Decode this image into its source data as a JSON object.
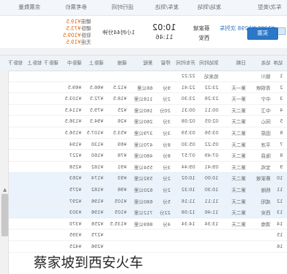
{
  "header": {
    "col_type": "车次/类型",
    "col_station": "发站/到站",
    "col_time": "发车/到达",
    "col_duration": "运行时间",
    "col_price": "参考票价",
    "col_ticket": "余票数量"
  },
  "train": {
    "number": "K1295/K1298 次列车",
    "type": "快速",
    "from": "蔡家坡",
    "to": "西安",
    "dep": "10:02",
    "arr": "11:46",
    "duration": "1小时44分钟",
    "prices": [
      {
        "label": "硬座",
        "value": "¥19.5"
      },
      {
        "label": "硬卧",
        "value": "¥73.5"
      },
      {
        "label": "软卧",
        "value": "¥109.5"
      },
      {
        "label": "无座",
        "value": "¥19.5"
      }
    ],
    "buy_label": "买票"
  },
  "table": {
    "columns": [
      "站序",
      "站名",
      "日期",
      "到站时间",
      "开车时间",
      "停留",
      "里程",
      "硬座",
      "硬卧上",
      "硬卧中",
      "硬卧下",
      "软卧上",
      "软卧下"
    ],
    "rows": [
      {
        "seq": "1",
        "station": "银川",
        "day": "",
        "arr": "始发站",
        "dep": "22:22",
        "stop": "",
        "km": "",
        "yz": "",
        "ys": "",
        "yzh": "",
        "yx": "",
        "rs": "",
        "rx": ""
      },
      {
        "seq": "2",
        "station": "青铜峡",
        "day": "第一天",
        "arr": "23:22",
        "dep": "22:41",
        "stop": "9分",
        "km": "66公里",
        "yz": "¥12.5",
        "ys": "¥66.5",
        "yzh": "¥69.5",
        "yx": "",
        "rs": "",
        "rx": ""
      },
      {
        "seq": "3",
        "station": "中宁",
        "day": "第一天",
        "arr": "23:28",
        "dep": "23:30",
        "stop": "2分",
        "km": "118公里",
        "yz": "¥18.5",
        "ys": "¥72.5",
        "yzh": "¥103.5",
        "yx": "",
        "rs": "",
        "rx": ""
      },
      {
        "seq": "4",
        "station": "中卫",
        "day": "第二天",
        "arr": "00:11",
        "dep": "00:31",
        "stop": "20分",
        "km": "160公里",
        "yz": "¥25",
        "ys": "¥79.5",
        "yzh": "¥114.5",
        "yx": "",
        "rs": "",
        "rx": ""
      },
      {
        "seq": "5",
        "station": "同心",
        "day": "第二天",
        "arr": "02:05",
        "dep": "02:08",
        "stop": "3分",
        "km": "260公里",
        "yz": "¥26",
        "ys": "¥94.5",
        "yzh": "¥136.5",
        "yx": "",
        "rs": "",
        "rx": ""
      },
      {
        "seq": "6",
        "station": "固原",
        "day": "第二天",
        "arr": "03:56",
        "dep": "03:59",
        "stop": "3分",
        "km": "379公里",
        "yz": "¥53.5",
        "ys": "¥107.5",
        "yzh": "¥156.5",
        "yx": "",
        "rs": "",
        "rx": ""
      },
      {
        "seq": "7",
        "station": "平凉",
        "day": "第二天",
        "arr": "05:22",
        "dep": "05:30",
        "stop": "8分",
        "km": "470公里",
        "yz": "¥69",
        "ys": "¥130",
        "yzh": "¥194",
        "yx": "",
        "rs": "",
        "rx": ""
      },
      {
        "seq": "8",
        "station": "陇县",
        "day": "第二天",
        "arr": "07:49",
        "dep": "07:57",
        "stop": "8分",
        "km": "480公里",
        "yz": "¥78",
        "ys": "¥160",
        "yzh": "¥227",
        "yx": "",
        "rs": "",
        "rx": ""
      },
      {
        "seq": "9",
        "station": "宝鸡",
        "day": "第二天",
        "arr": "09:41",
        "dep": "09:44",
        "stop": "3分",
        "km": "554公里",
        "yz": "¥91",
        "ys": "¥182",
        "yzh": "¥258",
        "yx": "",
        "rs": "",
        "rx": ""
      },
      {
        "seq": "10",
        "station": "蔡家坡",
        "day": "第二天",
        "arr": "10:00",
        "dep": "10:02",
        "stop": "2分",
        "km": "592公里",
        "yz": "¥93",
        "ys": "¥174",
        "yzh": "¥263",
        "yx": "",
        "rs": "",
        "rx": ""
      },
      {
        "seq": "11",
        "station": "杨陵",
        "day": "第二天",
        "arr": "10:30",
        "dep": "10:32",
        "stop": "2分",
        "km": "620公里",
        "yz": "¥98",
        "ys": "¥182",
        "yzh": "¥275",
        "yx": "",
        "rs": "",
        "rx": ""
      },
      {
        "seq": "12",
        "station": "咸阳",
        "day": "第二天",
        "arr": "11:11",
        "dep": "11:16",
        "stop": "5分",
        "km": "680公里",
        "yz": "¥105",
        "ys": "¥196",
        "yzh": "¥297",
        "yx": "",
        "rs": "",
        "rx": ""
      },
      {
        "seq": "13",
        "station": "西安",
        "day": "第二天",
        "arr": "11:46",
        "dep": "12:08",
        "stop": "22分",
        "km": "712公里",
        "yz": "¥105",
        "ys": "¥196",
        "yzh": "¥303",
        "yx": "",
        "rs": "",
        "rx": ""
      },
      {
        "seq": "14",
        "station": "渭南",
        "day": "第二天",
        "arr": "13:34",
        "dep": "14:34",
        "stop": "4分",
        "km": "869公里",
        "yz": "¥135.5",
        "ys": "¥256",
        "yzh": "¥370",
        "yx": "",
        "rs": "",
        "rx": ""
      },
      {
        "seq": "15",
        "station": "",
        "day": "",
        "arr": "",
        "dep": "",
        "stop": "",
        "km": "",
        "yz": "",
        "ys": "¥275",
        "yzh": "¥395",
        "yx": "",
        "rs": "",
        "rx": ""
      },
      {
        "seq": "16",
        "station": "",
        "day": "",
        "arr": "",
        "dep": "",
        "stop": "",
        "km": "",
        "yz": "",
        "ys": "¥296",
        "yzh": "¥425",
        "yx": "",
        "rs": "",
        "rx": ""
      }
    ]
  },
  "watermark": "蔡家坡到西安火车",
  "colors": {
    "accent": "#2c78c8",
    "price": "#e4660f",
    "highlight_row": "#eaf3fb"
  }
}
